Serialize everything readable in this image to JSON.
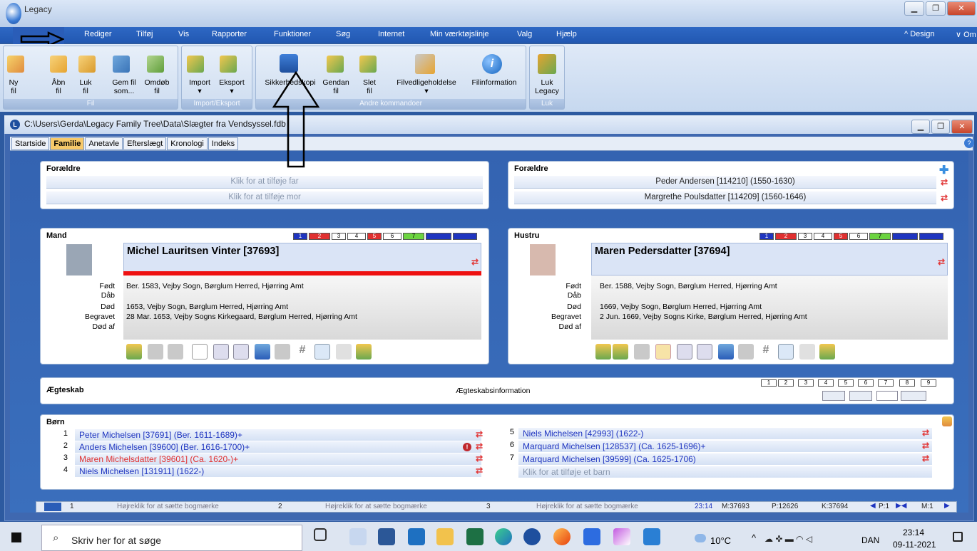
{
  "app": {
    "title": "Legacy"
  },
  "menu": [
    "Rediger",
    "Tilføj",
    "Vis",
    "Rapporter",
    "Funktioner",
    "Søg",
    "Internet",
    "Min værktøjslinje",
    "Valg",
    "Hjælp"
  ],
  "menu_right": {
    "design": "^ Design",
    "om": "∨ Om"
  },
  "ribbon": {
    "fil": {
      "label": "Fil",
      "buttons": [
        "Ny\nfil",
        "Åbn\nfil",
        "Luk\nfil",
        "Gem fil\nsom...",
        "Omdøb\nfil"
      ]
    },
    "import": {
      "label": "Import/Eksport",
      "buttons": [
        "Import\n▾",
        "Eksport\n▾"
      ]
    },
    "andre": {
      "label": "Andre kommandoer",
      "buttons": [
        "Sikkerhedskopi",
        "Gendan\nfil",
        "Slet\nfil",
        "Filvedligeholdelse\n▾",
        "Filinformation"
      ]
    },
    "luk": {
      "label": "Luk",
      "buttons": [
        "Luk\nLegacy"
      ]
    }
  },
  "document": {
    "path": "C:\\Users\\Gerda\\Legacy Family Tree\\Data\\Slægter fra Vendsyssel.fdb"
  },
  "tabs": [
    "Startside",
    "Familie",
    "Anetavle",
    "Efterslægt",
    "Kronologi",
    "Indeks"
  ],
  "parents_left": {
    "header": "Forældre",
    "father": "Klik for at tilføje far",
    "mother": "Klik for at tilføje mor"
  },
  "parents_right": {
    "header": "Forældre",
    "father": "Peder Andersen [114210] (1550-1630)",
    "mother": "Margrethe Poulsdatter [114209] (1560-1646)"
  },
  "husband": {
    "header": "Mand",
    "name": "Michel Lauritsen Vinter [37693]",
    "labels": [
      "Født",
      "Dåb",
      "Død",
      "Begravet",
      "Død af"
    ],
    "values": [
      "Ber. 1583, Vejby Sogn, Børglum Herred, Hjørring Amt",
      "",
      "1653, Vejby Sogn, Børglum Herred, Hjørring Amt",
      "28 Mar. 1653, Vejby Sogns Kirkegaard, Børglum Herred, Hjørring Amt",
      ""
    ]
  },
  "wife": {
    "header": "Hustru",
    "name": "Maren Pedersdatter [37694]",
    "labels": [
      "Født",
      "Dåb",
      "Død",
      "Begravet",
      "Død af"
    ],
    "values": [
      "Ber. 1588, Vejby Sogn, Børglum Herred, Hjørring Amt",
      "",
      "1669, Vejby Sogn, Børglum Herred, Hjørring Amt",
      "2 Jun. 1669, Vejby Sogns Kirke, Børglum Herred, Hjørring Amt",
      ""
    ]
  },
  "color_tags": [
    "1",
    "2",
    "3",
    "4",
    "5",
    "6",
    "7",
    "",
    ""
  ],
  "marriage": {
    "header": "Ægteskab",
    "info": "Ægteskabsinformation",
    "numbers": [
      "1",
      "2",
      "3",
      "4",
      "5",
      "6",
      "7",
      "8",
      "9"
    ]
  },
  "children": {
    "header": "Børn",
    "left": [
      {
        "n": "1",
        "name": "Peter Michelsen [37691] (Ber. 1611-1689)+",
        "color": "#1f35c0"
      },
      {
        "n": "2",
        "name": "Anders Michelsen [39600] (Ber. 1616-1700)+",
        "color": "#1f35c0"
      },
      {
        "n": "3",
        "name": "Maren Michelsdatter [39601] (Ca. 1620-)+",
        "color": "#e03030"
      },
      {
        "n": "4",
        "name": "Niels Michelsen [131911] (1622-)",
        "color": "#1f35c0"
      }
    ],
    "right": [
      {
        "n": "5",
        "name": "Niels Michelsen [42993] (1622-)",
        "color": "#1f35c0"
      },
      {
        "n": "6",
        "name": "Marquard Michelsen [128537] (Ca. 1625-1696)+",
        "color": "#1f35c0"
      },
      {
        "n": "7",
        "name": "Marquard Michelsen [39599] (Ca. 1625-1706)",
        "color": "#1f35c0"
      }
    ],
    "add": "Klik for at tilføje et barn"
  },
  "statusbar": {
    "bm1": "1",
    "bm2": "2",
    "bm3": "3",
    "hint": "Højreklik for at sætte bogmærke",
    "time": "23:14",
    "m": "M:37693",
    "p": "P:12626",
    "k": "K:37694",
    "page": "P:1",
    "mpage": "M:1"
  },
  "taskbar": {
    "search": "Skriv her for at søge",
    "weather": "10°C",
    "lang": "DAN",
    "clock": "23:14",
    "date": "09-11-2021"
  },
  "colors": {
    "accent": "#2258b2",
    "red": "#e03030",
    "link": "#1f35c0"
  }
}
